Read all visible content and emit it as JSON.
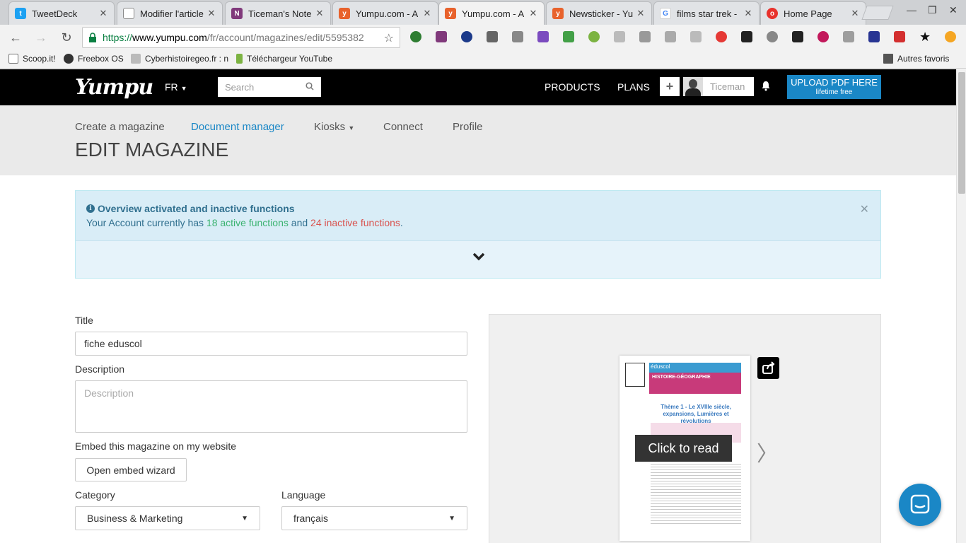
{
  "browser": {
    "tabs": [
      {
        "title": "TweetDeck",
        "favicon_color": "#1da1f2",
        "favicon_glyph": "twitter-icon"
      },
      {
        "title": "Modifier l'article",
        "favicon_color": "#ffffff",
        "favicon_glyph": "page-icon"
      },
      {
        "title": "Ticeman's Note",
        "favicon_color": "#80397b",
        "favicon_glyph": "onenote-icon"
      },
      {
        "title": "Yumpu.com - A",
        "favicon_color": "#e8622c",
        "favicon_glyph": "yumpu-icon"
      },
      {
        "title": "Yumpu.com - A",
        "favicon_color": "#e8622c",
        "favicon_glyph": "yumpu-icon"
      },
      {
        "title": "Newsticker - Yu",
        "favicon_color": "#e8622c",
        "favicon_glyph": "yumpu-icon"
      },
      {
        "title": "films star trek - I",
        "favicon_color": "#4285f4",
        "favicon_glyph": "google-icon"
      },
      {
        "title": "Home Page",
        "favicon_color": "#e8322c",
        "favicon_glyph": "vivaldi-icon"
      }
    ],
    "active_tab": 4,
    "url": {
      "scheme": "https://",
      "host": "www.yumpu.com",
      "path": "/fr/account/magazines/edit/5595382"
    },
    "bookmarks": [
      {
        "label": "Scoop.it!"
      },
      {
        "label": "Freebox OS"
      },
      {
        "label": "Cyberhistoiregeo.fr : n"
      },
      {
        "label": "Téléchargeur YouTube"
      },
      {
        "label": "Autres favoris"
      }
    ]
  },
  "yumpu": {
    "logo": "Yumpu",
    "lang": "FR",
    "search_placeholder": "Search",
    "nav": {
      "products": "PRODUCTS",
      "plans": "PLANS"
    },
    "plus": "+",
    "username": "Ticeman",
    "upload": {
      "line1": "UPLOAD PDF HERE",
      "line2": "lifetime free"
    },
    "subnav": [
      {
        "label": "Create a magazine"
      },
      {
        "label": "Document manager"
      },
      {
        "label": "Kiosks"
      },
      {
        "label": "Connect"
      },
      {
        "label": "Profile"
      }
    ],
    "page_title": "EDIT MAGAZINE",
    "alert": {
      "heading": "Overview activated and inactive functions",
      "text_prefix": "Your Account currently has ",
      "active": "18 active functions",
      "text_mid": " and ",
      "inactive": "24 inactive functions",
      "text_suffix": "."
    },
    "form": {
      "title_label": "Title",
      "title_value": "fiche eduscol",
      "description_label": "Description",
      "description_placeholder": "Description",
      "embed_label": "Embed this magazine on my website",
      "embed_button": "Open embed wizard",
      "category_label": "Category",
      "category_value": "Business & Marketing",
      "language_label": "Language",
      "language_value": "français"
    },
    "preview": {
      "click_to_read": "Click to read",
      "doc_title": "Thème 1 - Le XVIIIe siècle, expansions, Lumières et révolutions",
      "doc_band": "HISTOIRE-GÉOGRAPHIE",
      "doc_brand": "éduscol"
    }
  }
}
